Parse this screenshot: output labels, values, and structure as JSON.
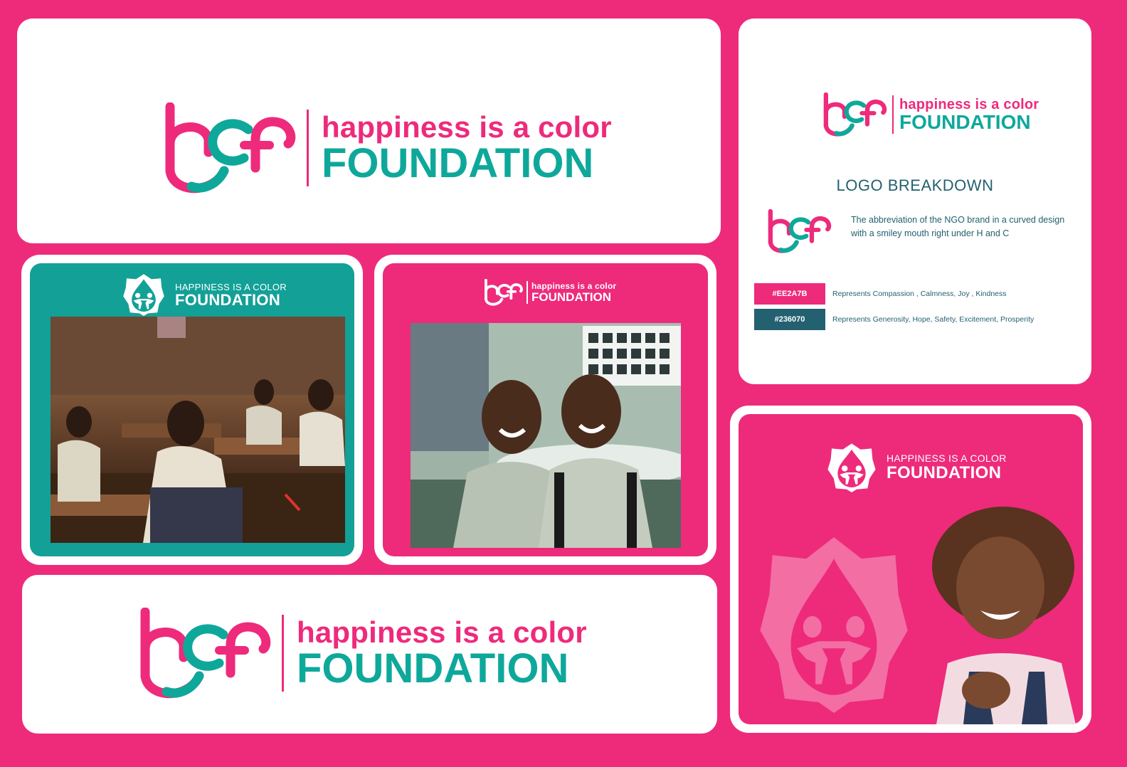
{
  "brand": {
    "monogram": "hcf",
    "tagline": "happiness is a color",
    "name": "FOUNDATION",
    "emblem_subtitle": "HAPPINESS IS A COLOR",
    "emblem_name": "FOUNDATION"
  },
  "breakdown": {
    "title": "LOGO BREAKDOWN",
    "description": "The abbreviation of the NGO brand in a curved design with a smiley mouth right under H and C",
    "colors": [
      {
        "hex": "#EE2A7B",
        "label": "#EE2A7B",
        "meaning": "Represents Compassion , Calmness, Joy , Kindness"
      },
      {
        "hex": "#236070",
        "label": "#236070",
        "meaning": "Represents Generosity, Hope, Safety, Excitement, Prosperity"
      }
    ]
  },
  "photos": {
    "classroom": "classroom-photo",
    "boys": "two-boys-photo",
    "girl": "smiling-girl-photo"
  },
  "colors": {
    "pink": "#ee2a7b",
    "teal": "#0ea89b",
    "dark_teal": "#236070",
    "panel_teal": "#13a097"
  }
}
